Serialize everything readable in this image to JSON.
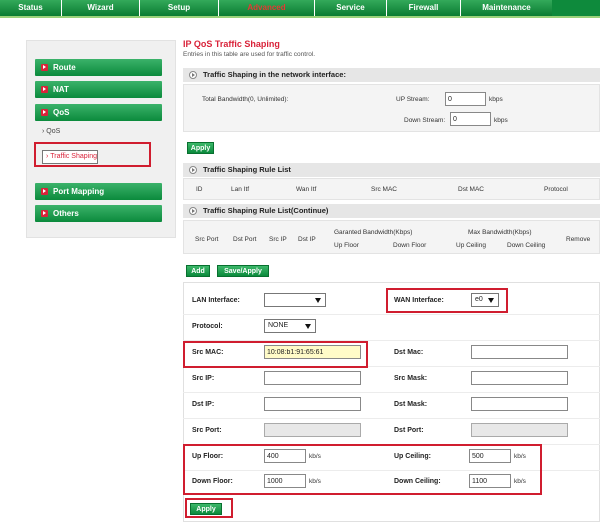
{
  "nav": {
    "tabs": [
      "Status",
      "Wizard",
      "Setup",
      "Advanced",
      "Service",
      "Firewall",
      "Maintenance"
    ],
    "active": "Advanced"
  },
  "sidebar": {
    "route": "Route",
    "nat": "NAT",
    "qos": "QoS",
    "qos_sub": "QoS",
    "traffic_shaping": "Traffic Shaping",
    "port_mapping": "Port Mapping",
    "others": "Others"
  },
  "page": {
    "title": "IP QoS Traffic Shaping",
    "description": "Entries in this table are used for traffic control."
  },
  "iface": {
    "header": "Traffic Shaping in the network interface:",
    "total_bw_label": "Total Bandwidth(0, Unlimited):",
    "up_label": "UP Stream:",
    "up_value": "0",
    "up_unit": "kbps",
    "down_label": "Down Stream:",
    "down_value": "0",
    "down_unit": "kbps",
    "apply": "Apply"
  },
  "rule_list": {
    "header": "Traffic Shaping Rule List",
    "columns": [
      "ID",
      "Lan Itf",
      "Wan Itf",
      "Src MAC",
      "Dst MAC",
      "Protocol"
    ]
  },
  "rule_list_cont": {
    "header": "Traffic Shaping Rule List(Continue)",
    "columns": [
      "Src Port",
      "Dst Port",
      "Src IP",
      "Dst IP"
    ],
    "gar_group": "Garanted Bandwidth(Kbps)",
    "max_group": "Max Bandwidth(Kbps)",
    "up_floor": "Up Floor",
    "down_floor": "Down Floor",
    "up_ceiling": "Up Ceiling",
    "down_ceiling": "Down Ceiling",
    "remove": "Remove"
  },
  "actions": {
    "add": "Add",
    "save_apply": "Save/Apply"
  },
  "form": {
    "lan_label": "LAN Interface:",
    "lan_value": "",
    "wan_label": "WAN Interface:",
    "wan_value": "e0",
    "protocol_label": "Protocol:",
    "protocol_value": "NONE",
    "src_mac_label": "Src MAC:",
    "src_mac_value": "10:08:b1:91:65:61",
    "dst_mac_label": "Dst Mac:",
    "src_ip_label": "Src IP:",
    "src_mask_label": "Src Mask:",
    "dst_ip_label": "Dst IP:",
    "dst_mask_label": "Dst Mask:",
    "src_port_label": "Src Port:",
    "dst_port_label": "Dst Port:",
    "up_floor_label": "Up Floor:",
    "up_floor_value": "400",
    "up_ceiling_label": "Up Ceiling:",
    "up_ceiling_value": "500",
    "down_floor_label": "Down Floor:",
    "down_floor_value": "1000",
    "down_ceiling_label": "Down Ceiling:",
    "down_ceiling_value": "1100",
    "unit": "kb/s",
    "apply": "Apply"
  }
}
